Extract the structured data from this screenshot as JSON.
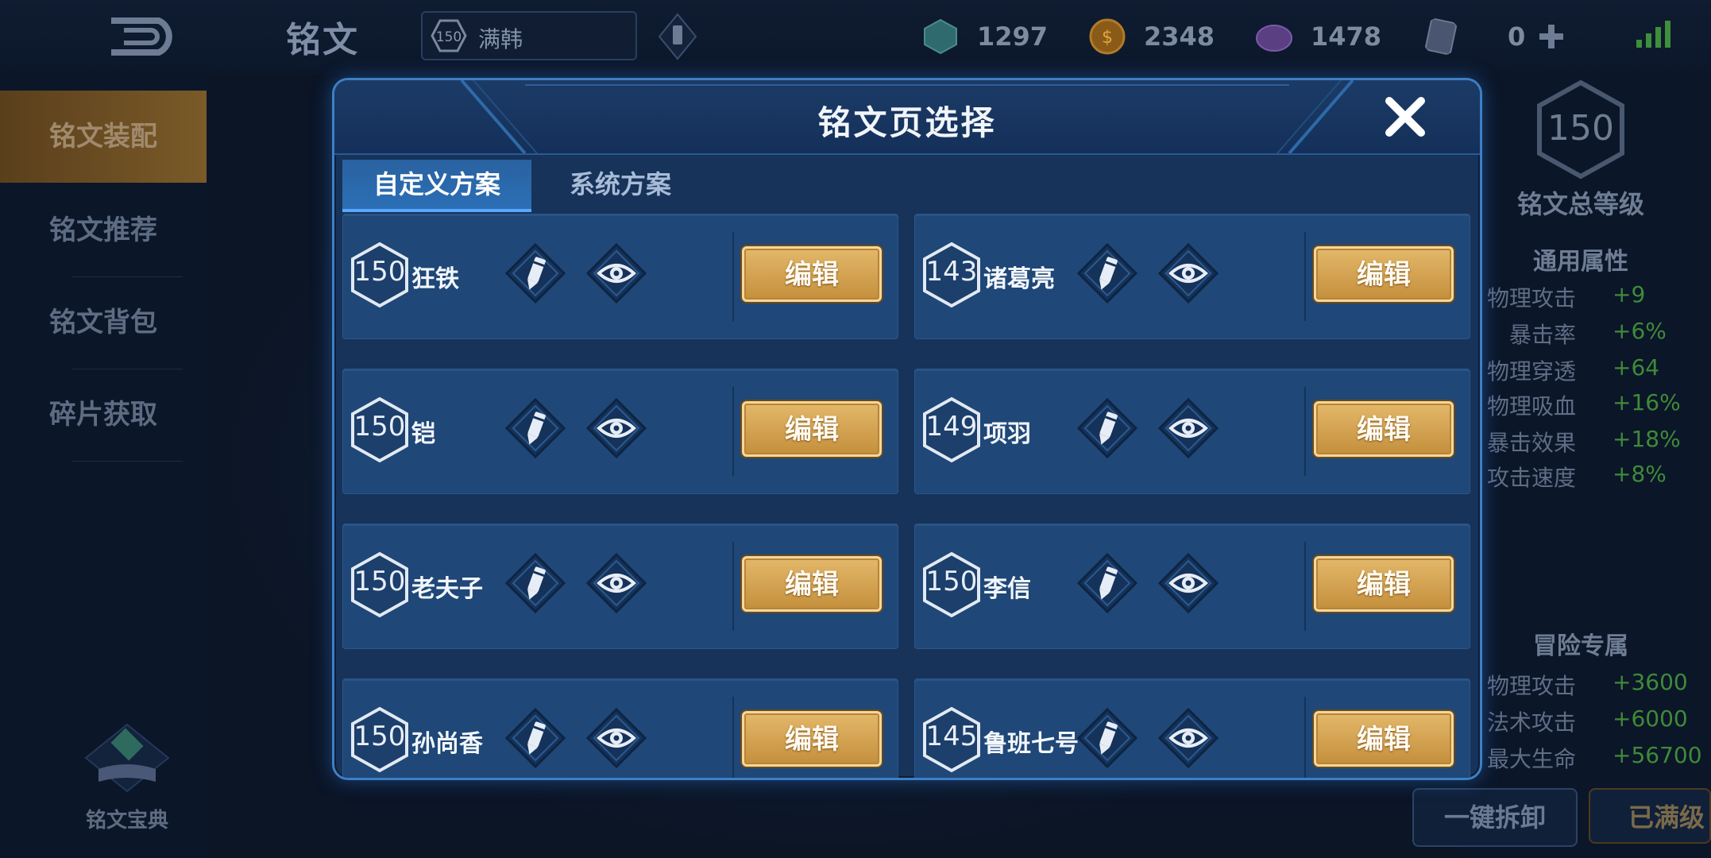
{
  "topbar": {
    "title": "铭文",
    "page_selector": {
      "level": "150",
      "name": "满韩"
    },
    "currencies": [
      {
        "icon": "crystal-icon",
        "value": "1297"
      },
      {
        "icon": "gold-coin-icon",
        "value": "2348"
      },
      {
        "icon": "gem-icon",
        "value": "1478"
      },
      {
        "icon": "card-icon",
        "value": "0"
      }
    ]
  },
  "sidebar": {
    "items": [
      {
        "label": "铭文装配",
        "active": true
      },
      {
        "label": "铭文推荐",
        "active": false
      },
      {
        "label": "铭文背包",
        "active": false
      },
      {
        "label": "碎片获取",
        "active": false
      }
    ],
    "codex_label": "铭文宝典"
  },
  "right_panel": {
    "total_level": "150",
    "total_level_label": "铭文总等级",
    "general_title": "通用属性",
    "general_stats": [
      {
        "name": "物理攻击",
        "value": "+9"
      },
      {
        "name": "暴击率",
        "value": "+6%"
      },
      {
        "name": "物理穿透",
        "value": "+64"
      },
      {
        "name": "物理吸血",
        "value": "+16%"
      },
      {
        "name": "暴击效果",
        "value": "+18%"
      },
      {
        "name": "攻击速度",
        "value": "+8%"
      }
    ],
    "adventure_title": "冒险专属",
    "adventure_stats": [
      {
        "name": "物理攻击",
        "value": "+3600"
      },
      {
        "name": "法术攻击",
        "value": "+6000"
      },
      {
        "name": "最大生命",
        "value": "+56700"
      }
    ],
    "unequip_label": "一键拆卸",
    "maxed_label": "已满级"
  },
  "modal": {
    "title": "铭文页选择",
    "tabs": [
      {
        "label": "自定义方案",
        "active": true
      },
      {
        "label": "系统方案",
        "active": false
      }
    ],
    "edit_label": "编辑",
    "pages": [
      {
        "level": "150",
        "name": "狂铁"
      },
      {
        "level": "143",
        "name": "诸葛亮"
      },
      {
        "level": "150",
        "name": "铠"
      },
      {
        "level": "149",
        "name": "项羽"
      },
      {
        "level": "150",
        "name": "老夫子"
      },
      {
        "level": "150",
        "name": "李信"
      },
      {
        "level": "150",
        "name": "孙尚香"
      },
      {
        "level": "145",
        "name": "鲁班七号"
      }
    ]
  },
  "colors": {
    "accent_gold": "#d4a557",
    "modal_border": "#3e7fc4",
    "stat_green": "#3f8a38"
  }
}
